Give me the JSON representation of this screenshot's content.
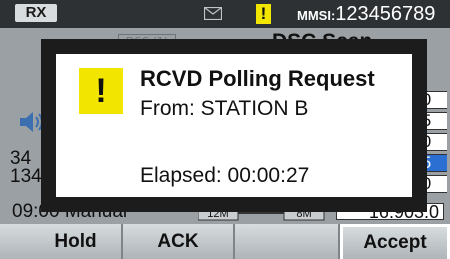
{
  "status_bar": {
    "rx_label": "RX",
    "mmsi_label": "MMSI:",
    "mmsi_value": "123456789",
    "icons": [
      "mail-icon",
      "warning-icon"
    ]
  },
  "background": {
    "dsc_tag": "DSC (1)",
    "title": "DSC Scan",
    "left_value_1": "34",
    "left_value_2": "134",
    "time_mode": "09:00 Manual",
    "band_start": "12M",
    "band_end": "8M",
    "colon": ":",
    "right_values": [
      ".0",
      ".5",
      ".0",
      ".5",
      ".0"
    ],
    "frequency": "16.903.0"
  },
  "dialog": {
    "icon": "warning-icon",
    "title": "RCVD Polling Request",
    "from": "From: STATION B",
    "elapsed": "Elapsed: 00:00:27"
  },
  "softkeys": {
    "hold": "Hold",
    "ack": "ACK",
    "blank": "",
    "accept": "Accept"
  },
  "colors": {
    "status_bar": "#2d3134",
    "warning": "#f2e600",
    "highlight": "#2c6fd2"
  }
}
